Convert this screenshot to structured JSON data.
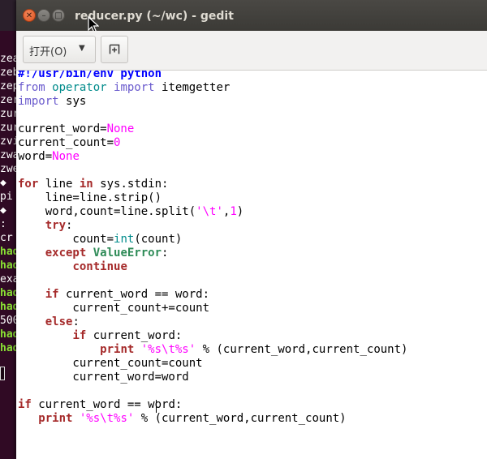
{
  "window": {
    "title": "reducer.py (~/wc) - gedit",
    "close_symbol": "✕",
    "minimize_symbol": "–",
    "maximize_symbol": "□"
  },
  "toolbar": {
    "open_label": "打开(O)",
    "open_arrow": "▼",
    "new_tab_icon": "new-document-icon"
  },
  "colors": {
    "keyword": "#a52a2a",
    "builtin_value": "#ff00ff",
    "import_keyword": "#6a5acd",
    "exception": "#2e8b57",
    "string": "#ff00ff",
    "number": "#ff00ff",
    "terminal_prompt": "#8ae234",
    "terminal_text": "#ffffff"
  },
  "terminal": {
    "lines": [
      {
        "text": "zea",
        "color": "#ffffff"
      },
      {
        "text": "zeb",
        "color": "#ffffff"
      },
      {
        "text": "zep",
        "color": "#ffffff"
      },
      {
        "text": "zer",
        "color": "#ffffff"
      },
      {
        "text": "zur",
        "color": "#ffffff"
      },
      {
        "text": "zur",
        "color": "#ffffff"
      },
      {
        "text": "zvi",
        "color": "#ffffff"
      },
      {
        "text": "zwa",
        "color": "#ffffff"
      },
      {
        "text": "zwe",
        "color": "#ffffff"
      },
      {
        "text": "\u0000",
        "color": "#ffffff"
      },
      {
        "text": "pi",
        "color": "#ffffff"
      },
      {
        "text": "\u0000",
        "color": "#ffffff"
      },
      {
        "text": ":",
        "color": "#ffffff"
      },
      {
        "text": "cr",
        "color": "#ffffff"
      },
      {
        "text": "had",
        "color": "#8ae234"
      },
      {
        "text": "had",
        "color": "#8ae234"
      },
      {
        "text": "exa",
        "color": "#ffffff"
      },
      {
        "text": "had",
        "color": "#8ae234"
      },
      {
        "text": "had",
        "color": "#8ae234"
      },
      {
        "text": "500",
        "color": "#ffffff"
      },
      {
        "text": "had",
        "color": "#8ae234"
      },
      {
        "text": "had",
        "color": "#8ae234"
      }
    ]
  },
  "code": {
    "lines": [
      [
        {
          "t": "#!/usr/bin/env python",
          "c": "#0000ff",
          "b": true
        }
      ],
      [
        {
          "t": "from ",
          "c": "#6a5acd"
        },
        {
          "t": "operator ",
          "c": "#008b8b"
        },
        {
          "t": "import ",
          "c": "#6a5acd"
        },
        {
          "t": "itemgetter",
          "c": "#000000"
        }
      ],
      [
        {
          "t": "import ",
          "c": "#6a5acd"
        },
        {
          "t": "sys",
          "c": "#000000"
        }
      ],
      [],
      [
        {
          "t": "current_word=",
          "c": "#000000"
        },
        {
          "t": "None",
          "c": "#ff00ff"
        }
      ],
      [
        {
          "t": "current_count=",
          "c": "#000000"
        },
        {
          "t": "0",
          "c": "#ff00ff"
        }
      ],
      [
        {
          "t": "word=",
          "c": "#000000"
        },
        {
          "t": "None",
          "c": "#ff00ff"
        }
      ],
      [],
      [
        {
          "t": "for ",
          "c": "#a52a2a",
          "b": true
        },
        {
          "t": "line ",
          "c": "#000000"
        },
        {
          "t": "in ",
          "c": "#a52a2a",
          "b": true
        },
        {
          "t": "sys.stdin:",
          "c": "#000000"
        }
      ],
      [
        {
          "t": "    line=line.strip()",
          "c": "#000000"
        }
      ],
      [
        {
          "t": "    word,count=line.split(",
          "c": "#000000"
        },
        {
          "t": "'\\t'",
          "c": "#ff00ff"
        },
        {
          "t": ",",
          "c": "#000000"
        },
        {
          "t": "1",
          "c": "#ff00ff"
        },
        {
          "t": ")",
          "c": "#000000"
        }
      ],
      [
        {
          "t": "    ",
          "c": "#000000"
        },
        {
          "t": "try",
          "c": "#a52a2a",
          "b": true
        },
        {
          "t": ":",
          "c": "#000000"
        }
      ],
      [
        {
          "t": "        count=",
          "c": "#000000"
        },
        {
          "t": "int",
          "c": "#008b8b"
        },
        {
          "t": "(count)",
          "c": "#000000"
        }
      ],
      [
        {
          "t": "    ",
          "c": "#000000"
        },
        {
          "t": "except ",
          "c": "#a52a2a",
          "b": true
        },
        {
          "t": "ValueError",
          "c": "#2e8b57",
          "b": true
        },
        {
          "t": ":",
          "c": "#000000"
        }
      ],
      [
        {
          "t": "        ",
          "c": "#000000"
        },
        {
          "t": "continue",
          "c": "#a52a2a",
          "b": true
        }
      ],
      [],
      [
        {
          "t": "    ",
          "c": "#000000"
        },
        {
          "t": "if ",
          "c": "#a52a2a",
          "b": true
        },
        {
          "t": "current_word == word:",
          "c": "#000000"
        }
      ],
      [
        {
          "t": "        current_count+=count",
          "c": "#000000"
        }
      ],
      [
        {
          "t": "    ",
          "c": "#000000"
        },
        {
          "t": "else",
          "c": "#a52a2a",
          "b": true
        },
        {
          "t": ":",
          "c": "#000000"
        }
      ],
      [
        {
          "t": "        ",
          "c": "#000000"
        },
        {
          "t": "if ",
          "c": "#a52a2a",
          "b": true
        },
        {
          "t": "current_word:",
          "c": "#000000"
        }
      ],
      [
        {
          "t": "            ",
          "c": "#000000"
        },
        {
          "t": "print ",
          "c": "#a52a2a",
          "b": true
        },
        {
          "t": "'%s\\t%s'",
          "c": "#ff00ff"
        },
        {
          "t": " % (current_word,current_count)",
          "c": "#000000"
        }
      ],
      [
        {
          "t": "        current_count=count",
          "c": "#000000"
        }
      ],
      [
        {
          "t": "        current_word=word",
          "c": "#000000"
        }
      ],
      [],
      [
        {
          "t": "if ",
          "c": "#a52a2a",
          "b": true
        },
        {
          "t": "current_word == word:",
          "c": "#000000"
        }
      ],
      [
        {
          "t": "   ",
          "c": "#000000"
        },
        {
          "t": "print ",
          "c": "#a52a2a",
          "b": true
        },
        {
          "t": "'%s\\t%s'",
          "c": "#ff00ff"
        },
        {
          "t": " % (current_word,current_count)",
          "c": "#000000"
        }
      ]
    ]
  }
}
